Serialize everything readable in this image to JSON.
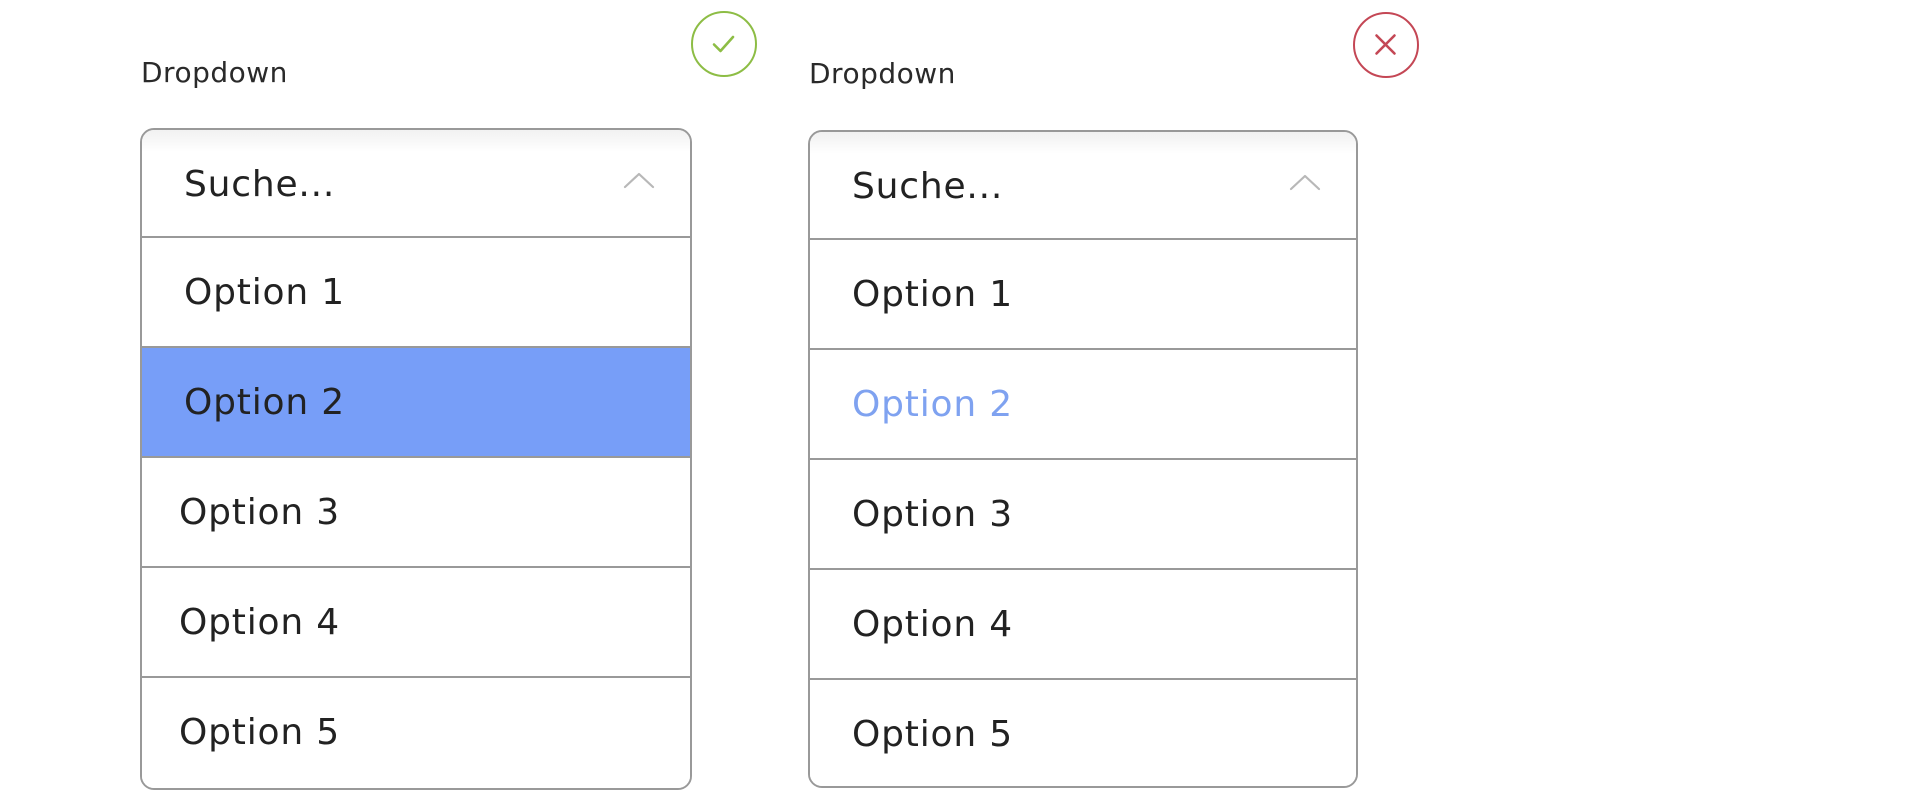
{
  "colors": {
    "good_badge": "#8dbd45",
    "bad_badge": "#c44755",
    "border": "#999999",
    "highlight_fill": "#779ef8",
    "highlight_text": "#7fa2f0",
    "text": "#222222"
  },
  "examples": [
    {
      "verdict_icon": "check-circle-icon",
      "label": "Dropdown",
      "search_placeholder": "Suche...",
      "chevron_icon": "chevron-up-icon",
      "selected_style": "filled-background",
      "options": [
        {
          "label": "Option 1",
          "selected": false
        },
        {
          "label": "Option 2",
          "selected": true
        },
        {
          "label": "Option 3",
          "selected": false
        },
        {
          "label": "Option 4",
          "selected": false
        },
        {
          "label": "Option 5",
          "selected": false
        }
      ]
    },
    {
      "verdict_icon": "x-circle-icon",
      "label": "Dropdown",
      "search_placeholder": "Suche...",
      "chevron_icon": "chevron-up-icon",
      "selected_style": "colored-text",
      "options": [
        {
          "label": "Option 1",
          "selected": false
        },
        {
          "label": "Option 2",
          "selected": true
        },
        {
          "label": "Option 3",
          "selected": false
        },
        {
          "label": "Option 4",
          "selected": false
        },
        {
          "label": "Option 5",
          "selected": false
        }
      ]
    }
  ]
}
